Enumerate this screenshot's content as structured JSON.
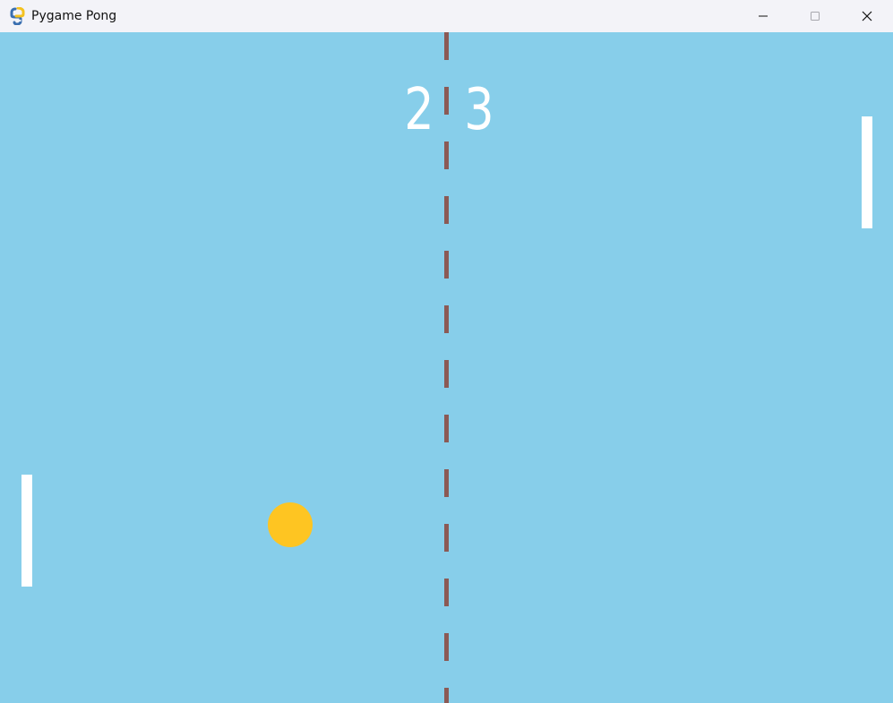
{
  "window": {
    "title": "Pygame Pong",
    "icon": "pygame-snake-icon",
    "controls": {
      "minimize_icon": "minimize-icon",
      "maximize_icon": "maximize-icon",
      "close_icon": "close-icon"
    }
  },
  "game": {
    "background_color": "#87ceea",
    "net_color": "#8b5a55",
    "paddle_color": "#ffffff",
    "ball_color": "#fec522",
    "score": {
      "left": "2",
      "right": "3"
    }
  }
}
